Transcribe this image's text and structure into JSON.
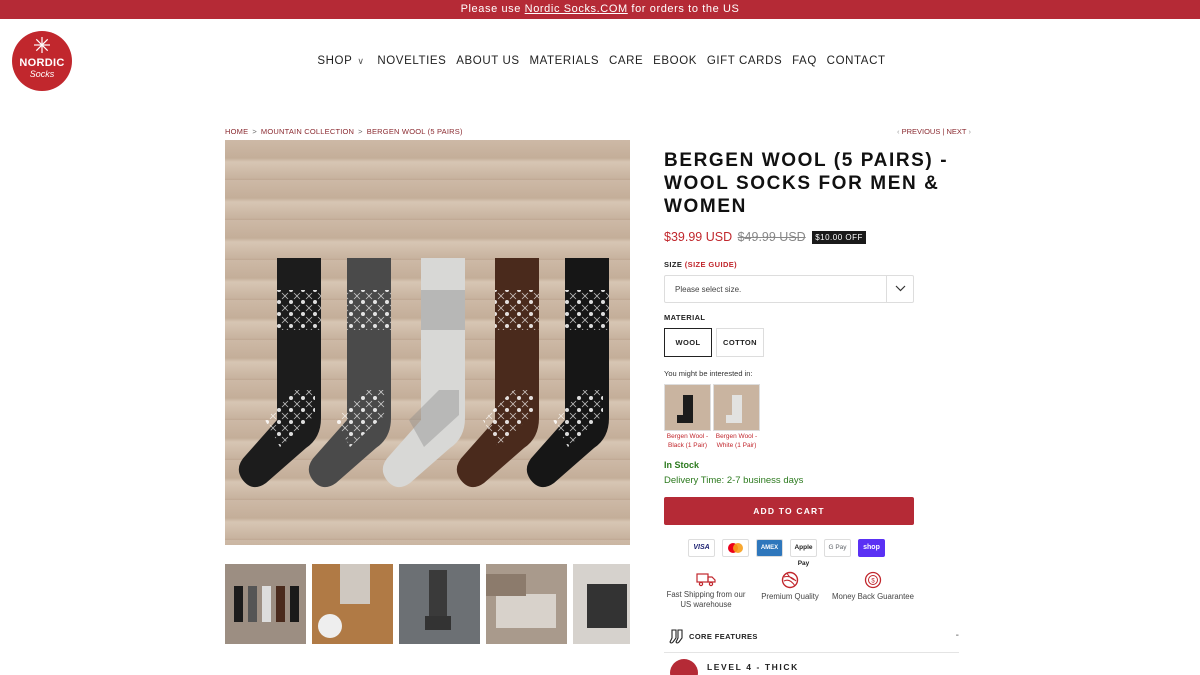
{
  "announcement": {
    "prefix": "Please use ",
    "link": "Nordic Socks.COM",
    "suffix": " for orders to the US"
  },
  "logo": {
    "line1": "NORDIC",
    "line2": "Socks"
  },
  "nav": {
    "items": [
      "SHOP",
      "NOVELTIES",
      "ABOUT US",
      "MATERIALS",
      "CARE",
      "EBOOK",
      "GIFT CARDS",
      "FAQ",
      "CONTACT"
    ]
  },
  "breadcrumb": {
    "home": "HOME",
    "collection": "MOUNTAIN COLLECTION",
    "current": "BERGEN WOOL (5 PAIRS)",
    "separator": ">"
  },
  "pager": {
    "previous": "PREVIOUS",
    "divider": "|",
    "next": "NEXT"
  },
  "product": {
    "title": "BERGEN WOOL (5 PAIRS) - WOOL SOCKS FOR MEN & WOMEN",
    "price": "$39.99 USD",
    "compare_price": "$49.99 USD",
    "discount_badge": "$10.00 OFF",
    "size_label": "SIZE",
    "size_guide": "(SIZE GUIDE)",
    "size_placeholder": "Please select size.",
    "material_label": "MATERIAL",
    "materials": [
      "WOOL",
      "COTTON"
    ],
    "selected_material": "WOOL",
    "interest_label": "You might be interested in:",
    "related": [
      {
        "name": "Bergen Wool - Black (1 Pair)"
      },
      {
        "name": "Bergen Wool - White (1 Pair)"
      }
    ],
    "stock": "In Stock",
    "delivery": "Delivery Time: 2-7 business days",
    "add_to_cart": "ADD TO CART"
  },
  "payments": [
    "VISA",
    "mastercard",
    "AMEX",
    "Apple Pay",
    "G Pay",
    "shop"
  ],
  "features": [
    {
      "icon": "truck-icon",
      "label": "Fast Shipping from our US warehouse"
    },
    {
      "icon": "yarn-ball-icon",
      "label": "Premium Quality"
    },
    {
      "icon": "money-back-icon",
      "label": "Money Back Guarantee"
    }
  ],
  "core_features": {
    "label": "CORE FEATURES",
    "toggle": "-"
  },
  "level": {
    "label": "LEVEL 4 - THICK"
  },
  "colors": {
    "brand": "#b52a36",
    "accent_text": "#c1272d",
    "in_stock": "#2c7a1e"
  }
}
